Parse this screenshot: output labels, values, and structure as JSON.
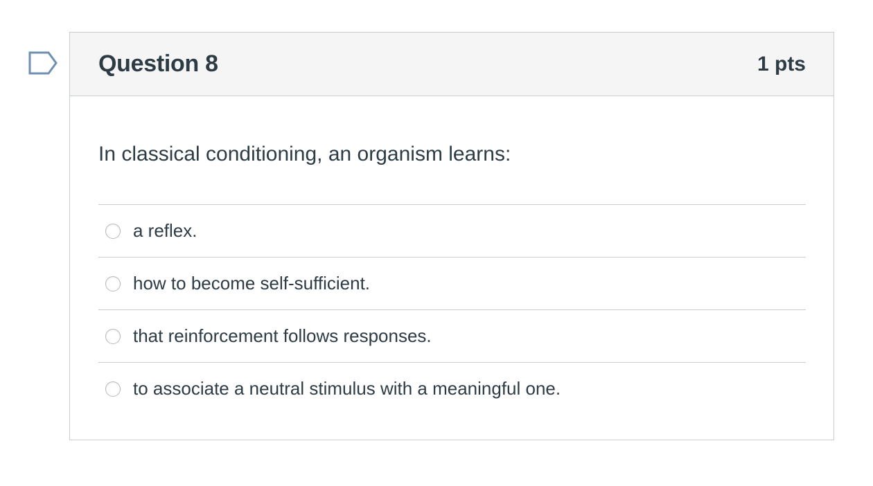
{
  "question": {
    "title": "Question 8",
    "points": "1 pts",
    "text": "In classical conditioning, an organism learns:",
    "answers": [
      {
        "label": "a reflex."
      },
      {
        "label": "how to become self-sufficient."
      },
      {
        "label": "that reinforcement follows responses."
      },
      {
        "label": "to associate a neutral stimulus with a meaningful one."
      }
    ]
  },
  "flag_icon": "flag-question-icon",
  "colors": {
    "flag_outline": "#6f8fb0",
    "header_bg": "#f5f5f5",
    "border": "#c7cdd1",
    "text": "#2d3b45"
  }
}
